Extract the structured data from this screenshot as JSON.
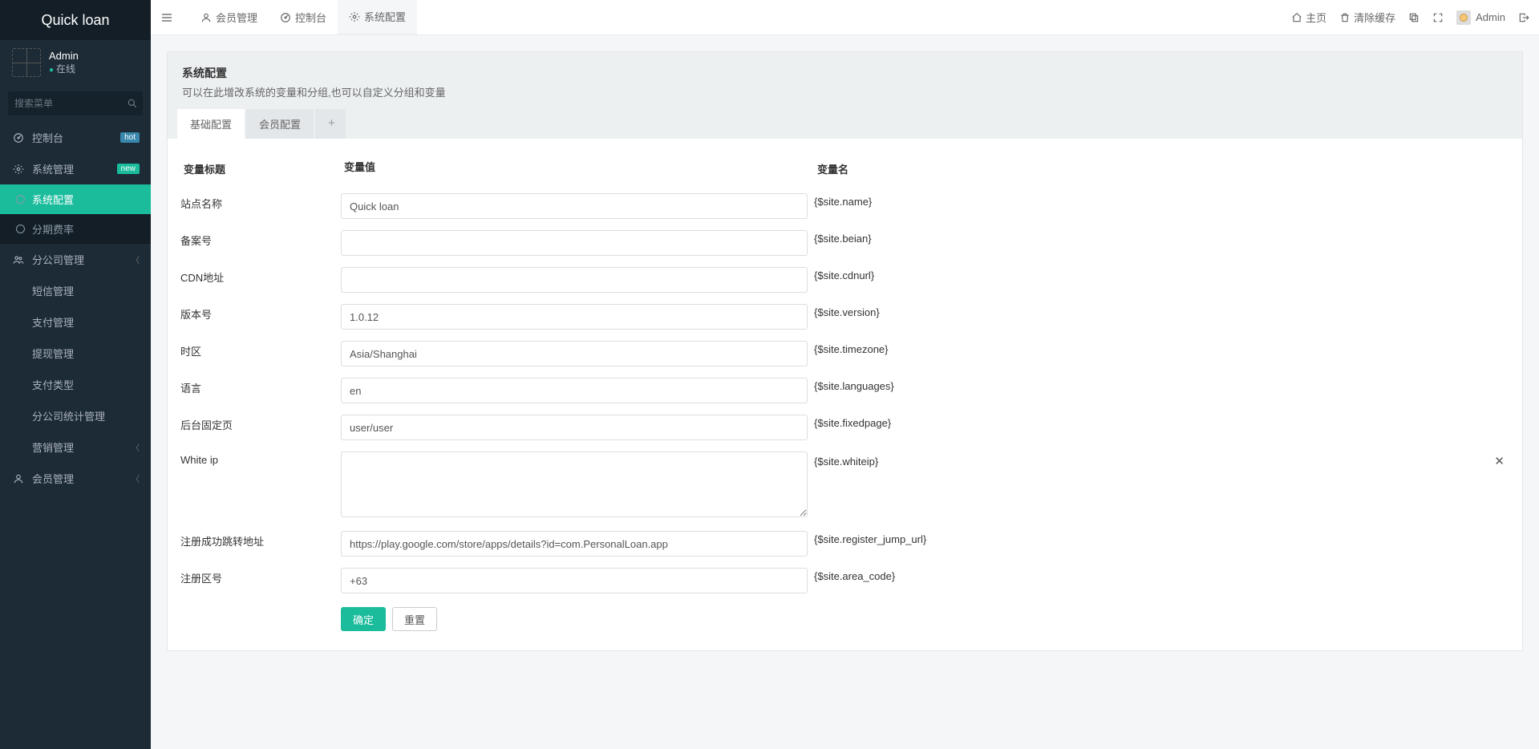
{
  "brand": "Quick loan",
  "user": {
    "name": "Admin",
    "status": "在线"
  },
  "sidebar": {
    "search_placeholder": "搜索菜单",
    "items": [
      {
        "icon": "dashboard",
        "label": "控制台",
        "badge": "hot"
      },
      {
        "icon": "cogs",
        "label": "系统管理",
        "badge": "new",
        "expanded": true,
        "children": [
          {
            "label": "系统配置",
            "active": true
          },
          {
            "label": "分期费率"
          }
        ]
      },
      {
        "icon": "users",
        "label": "分公司管理",
        "caret": true
      },
      {
        "icon": "circle",
        "label": "短信管理"
      },
      {
        "icon": "circle",
        "label": "支付管理"
      },
      {
        "icon": "circle",
        "label": "提现管理"
      },
      {
        "icon": "circle",
        "label": "支付类型"
      },
      {
        "icon": "circle",
        "label": "分公司统计管理"
      },
      {
        "icon": "circle",
        "label": "营销管理",
        "caret": true
      },
      {
        "icon": "user",
        "label": "会员管理",
        "caret": true
      }
    ]
  },
  "topbar": {
    "tabs": [
      {
        "icon": "user",
        "label": "会员管理"
      },
      {
        "icon": "dashboard",
        "label": "控制台"
      },
      {
        "icon": "gear",
        "label": "系统配置",
        "active": true
      }
    ],
    "home": "主页",
    "clear_cache": "清除缓存",
    "username": "Admin"
  },
  "panel": {
    "title": "系统配置",
    "subtitle": "可以在此增改系统的变量和分组,也可以自定义分组和变量"
  },
  "config_tabs": {
    "items": [
      {
        "label": "基础配置",
        "active": true
      },
      {
        "label": "会员配置"
      }
    ],
    "add": "+"
  },
  "table": {
    "headers": {
      "title": "变量标题",
      "value": "变量值",
      "name": "变量名"
    },
    "rows": [
      {
        "title": "站点名称",
        "value": "Quick loan",
        "var": "{$site.name}",
        "type": "text"
      },
      {
        "title": "备案号",
        "value": "",
        "var": "{$site.beian}",
        "type": "text"
      },
      {
        "title": "CDN地址",
        "value": "",
        "var": "{$site.cdnurl}",
        "type": "text"
      },
      {
        "title": "版本号",
        "value": "1.0.12",
        "var": "{$site.version}",
        "type": "text"
      },
      {
        "title": "时区",
        "value": "Asia/Shanghai",
        "var": "{$site.timezone}",
        "type": "text"
      },
      {
        "title": "语言",
        "value": "en",
        "var": "{$site.languages}",
        "type": "text"
      },
      {
        "title": "后台固定页",
        "value": "user/user",
        "var": "{$site.fixedpage}",
        "type": "text"
      },
      {
        "title": "White ip",
        "value": "",
        "var": "{$site.whiteip}",
        "type": "textarea",
        "removable": true
      },
      {
        "title": "注册成功跳转地址",
        "value": "https://play.google.com/store/apps/details?id=com.PersonalLoan.app",
        "var": "{$site.register_jump_url}",
        "type": "text"
      },
      {
        "title": "注册区号",
        "value": "+63",
        "var": "{$site.area_code}",
        "type": "text"
      }
    ]
  },
  "buttons": {
    "submit": "确定",
    "reset": "重置"
  }
}
